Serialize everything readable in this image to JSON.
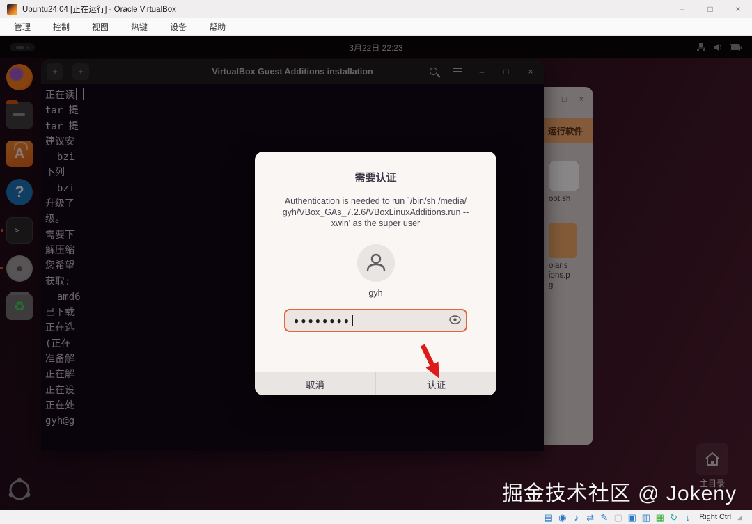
{
  "window": {
    "title": "Ubuntu24.04 [正在运行] - Oracle VirtualBox",
    "controls": {
      "minimize": "–",
      "maximize": "□",
      "close": "×"
    },
    "menu": [
      "管理",
      "控制",
      "视图",
      "热键",
      "设备",
      "帮助"
    ]
  },
  "desktop": {
    "clock": "3月22日 22:23",
    "tray_icons": [
      "network-icon",
      "volume-icon",
      "battery-icon"
    ],
    "dock_items": [
      "firefox",
      "files",
      "app-center",
      "help",
      "terminal",
      "cd-drive",
      "trash",
      "show-apps"
    ],
    "app_center_letter": "A",
    "help_glyph": "?",
    "terminal_glyph": ">_",
    "trash_glyph": "♻",
    "home_shortcut_label": "主目录",
    "watermark": "掘金技术社区 @ Jokeny"
  },
  "terminal": {
    "title": "VirtualBox Guest Additions installation",
    "new_tab_glyph": "+",
    "window_buttons": {
      "minimize": "–",
      "maximize": "□",
      "close": "×"
    },
    "lines": [
      "正在读",
      "tar 提",
      "tar 提",
      "建议安",
      "  bzi",
      "下列",
      "  bzi",
      "升级了",
      "级。",
      "需要下",
      "解压缩",
      "您希望",
      "获取:",
      "  amd6",
      "已下载",
      "正在选",
      "(正在",
      "准备解",
      "正在解",
      "正在设",
      "正在处",
      "gyh@g"
    ]
  },
  "file_manager": {
    "window_buttons": {
      "maximize": "□",
      "close": "×"
    },
    "run_button": "运行软件",
    "file1_label": "oot.sh",
    "file2_label_lines": [
      "olaris",
      "ions.p",
      "g"
    ]
  },
  "dialog": {
    "title": "需要认证",
    "message_lines": [
      "Authentication is needed to run `/bin/sh /media/",
      "gyh/VBox_GAs_7.2.6/VBoxLinuxAdditions.run --",
      "xwin' as the super user"
    ],
    "username": "gyh",
    "password_dots": "●●●●●●●●",
    "cancel_label": "取消",
    "authenticate_label": "认证",
    "accent_color": "#e8623c",
    "arrow_color": "#dd1c1a"
  },
  "statusbar": {
    "icon_names": [
      "hard-disks",
      "optical-drives",
      "audio",
      "network",
      "usb",
      "shared-folders",
      "display",
      "recording",
      "features",
      "mouse-integration",
      "keyboard"
    ],
    "icon_glyphs": [
      "▤",
      "◉",
      "♪",
      "⇄",
      "✎",
      "▢",
      "▣",
      "▥",
      "▦",
      "↻",
      "↓"
    ],
    "icon_colors": [
      "#2e77c8",
      "#2e77c8",
      "#2e77c8",
      "#2e77c8",
      "#2e77c8",
      "#b8b8b8",
      "#2e77c8",
      "#2e77c8",
      "#3fae3f",
      "#2aa9a0",
      "#2e77c8"
    ],
    "host_key": "Right Ctrl"
  }
}
